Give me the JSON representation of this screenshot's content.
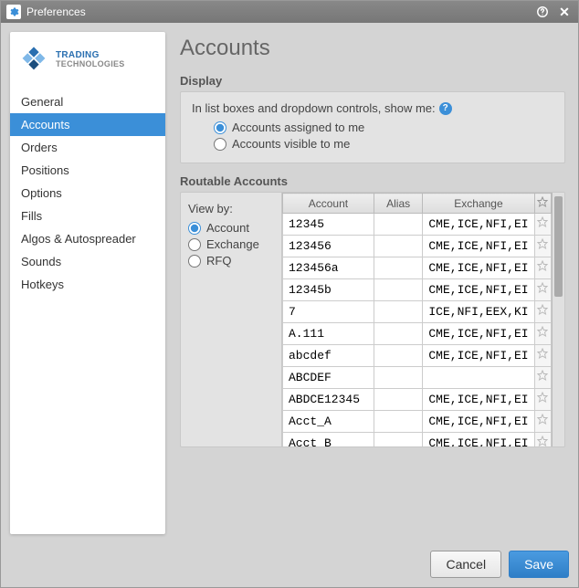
{
  "window": {
    "title": "Preferences"
  },
  "brand": {
    "line1a": "TRADING",
    "line2": "TECHNOLOGIES"
  },
  "sidebar": {
    "items": [
      {
        "label": "General"
      },
      {
        "label": "Accounts"
      },
      {
        "label": "Orders"
      },
      {
        "label": "Positions"
      },
      {
        "label": "Options"
      },
      {
        "label": "Fills"
      },
      {
        "label": "Algos & Autospreader"
      },
      {
        "label": "Sounds"
      },
      {
        "label": "Hotkeys"
      }
    ],
    "active_index": 1
  },
  "page": {
    "title": "Accounts"
  },
  "display": {
    "section_label": "Display",
    "prompt": "In list boxes and dropdown controls, show me:",
    "options": [
      {
        "label": "Accounts assigned to me",
        "checked": true
      },
      {
        "label": "Accounts visible to me",
        "checked": false
      }
    ]
  },
  "routable": {
    "section_label": "Routable Accounts",
    "viewby_label": "View by:",
    "viewby_options": [
      {
        "label": "Account",
        "checked": true
      },
      {
        "label": "Exchange",
        "checked": false
      },
      {
        "label": "RFQ",
        "checked": false
      }
    ],
    "columns": [
      "Account",
      "Alias",
      "Exchange"
    ],
    "rows": [
      {
        "account": "12345",
        "alias": "",
        "exchange": "CME,ICE,NFI,EI"
      },
      {
        "account": "123456",
        "alias": "",
        "exchange": "CME,ICE,NFI,EI"
      },
      {
        "account": "123456a",
        "alias": "",
        "exchange": "CME,ICE,NFI,EI"
      },
      {
        "account": "12345b",
        "alias": "",
        "exchange": "CME,ICE,NFI,EI"
      },
      {
        "account": "7",
        "alias": "",
        "exchange": "ICE,NFI,EEX,KI"
      },
      {
        "account": "A.111",
        "alias": "",
        "exchange": "CME,ICE,NFI,EI"
      },
      {
        "account": "abcdef",
        "alias": "",
        "exchange": "CME,ICE,NFI,EI"
      },
      {
        "account": "ABCDEF",
        "alias": "",
        "exchange": ""
      },
      {
        "account": "ABDCE12345",
        "alias": "",
        "exchange": "CME,ICE,NFI,EI"
      },
      {
        "account": "Acct_A",
        "alias": "",
        "exchange": "CME,ICE,NFI,EI"
      },
      {
        "account": "Acct_B",
        "alias": "",
        "exchange": "CME,ICE,NFI,EI"
      }
    ]
  },
  "buttons": {
    "cancel": "Cancel",
    "save": "Save"
  }
}
